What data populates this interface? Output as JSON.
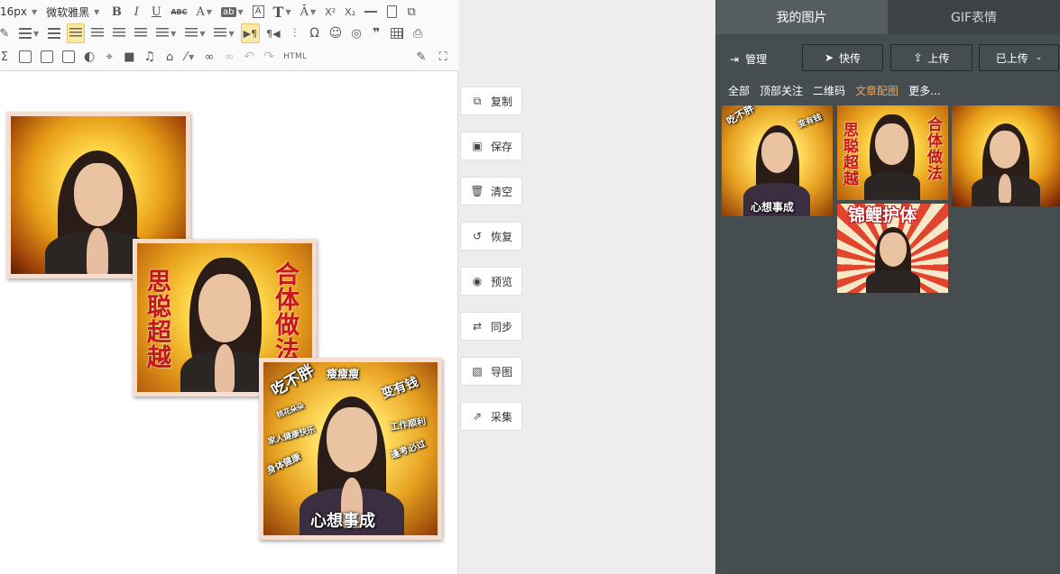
{
  "toolbar": {
    "font_size": "16px",
    "font_family": "微软雅黑",
    "abc_label": "ABC",
    "bold": "B",
    "italic": "I",
    "underline": "U",
    "font_color": "A",
    "text_t": "T",
    "omega": "Ω",
    "quote": "❞",
    "html_label": "HTML",
    "superscript": "X²",
    "subscript": "X₂"
  },
  "actions": [
    {
      "label": "复制",
      "icon": "copy-icon"
    },
    {
      "label": "保存",
      "icon": "save-icon"
    },
    {
      "label": "清空",
      "icon": "trash-icon"
    },
    {
      "label": "恢复",
      "icon": "restore-icon"
    },
    {
      "label": "预览",
      "icon": "eye-icon"
    },
    {
      "label": "同步",
      "icon": "sync-icon"
    },
    {
      "label": "导图",
      "icon": "image-export-icon"
    },
    {
      "label": "采集",
      "icon": "collect-icon"
    }
  ],
  "panel": {
    "tabs": [
      {
        "label": "我的图片",
        "active": true
      },
      {
        "label": "GIF表情",
        "active": false
      }
    ],
    "manage_label": "管理",
    "quick_upload": "快传",
    "upload": "上传",
    "uploaded": "已上传",
    "categories": [
      {
        "label": "全部",
        "active": false
      },
      {
        "label": "顶部关注",
        "active": false
      },
      {
        "label": "二维码",
        "active": false
      },
      {
        "label": "文章配图",
        "active": true
      },
      {
        "label": "更多...",
        "active": false
      }
    ]
  },
  "memes": {
    "m2_left": "思聪超越",
    "m2_right": "合体做法",
    "m3_bottom": "心想事成",
    "m3_words": [
      "吃不胖",
      "瘦瘦瘦",
      "变有钱",
      "家人健康快乐",
      "工作顺利",
      "身体健康",
      "逢考必过",
      "桃花朵朵"
    ],
    "t4_top": "锦鲤护体"
  },
  "colors": {
    "panel_bg": "#464d50",
    "tab_active": "#555d60",
    "category_active": "#f0a35e",
    "toolbar_selected": "#fbe9a8"
  }
}
